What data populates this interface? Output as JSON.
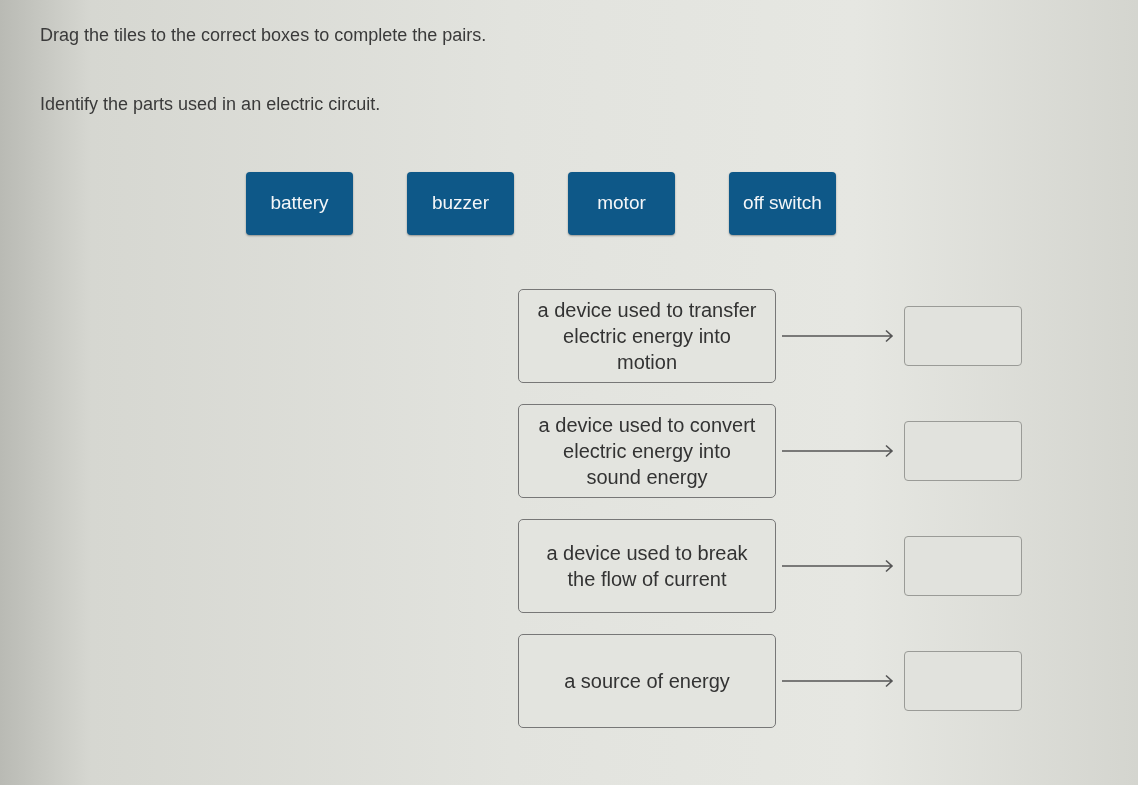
{
  "instructions": [
    "Drag the tiles to the correct boxes to complete the pairs.",
    "Identify the parts used in an electric circuit."
  ],
  "tiles": [
    "battery",
    "buzzer",
    "motor",
    "off switch"
  ],
  "pairs": [
    {
      "description": "a device used to transfer electric energy into motion"
    },
    {
      "description": "a device used to convert electric energy into sound energy"
    },
    {
      "description": "a device used to break the flow of current"
    },
    {
      "description": "a source of energy"
    }
  ]
}
